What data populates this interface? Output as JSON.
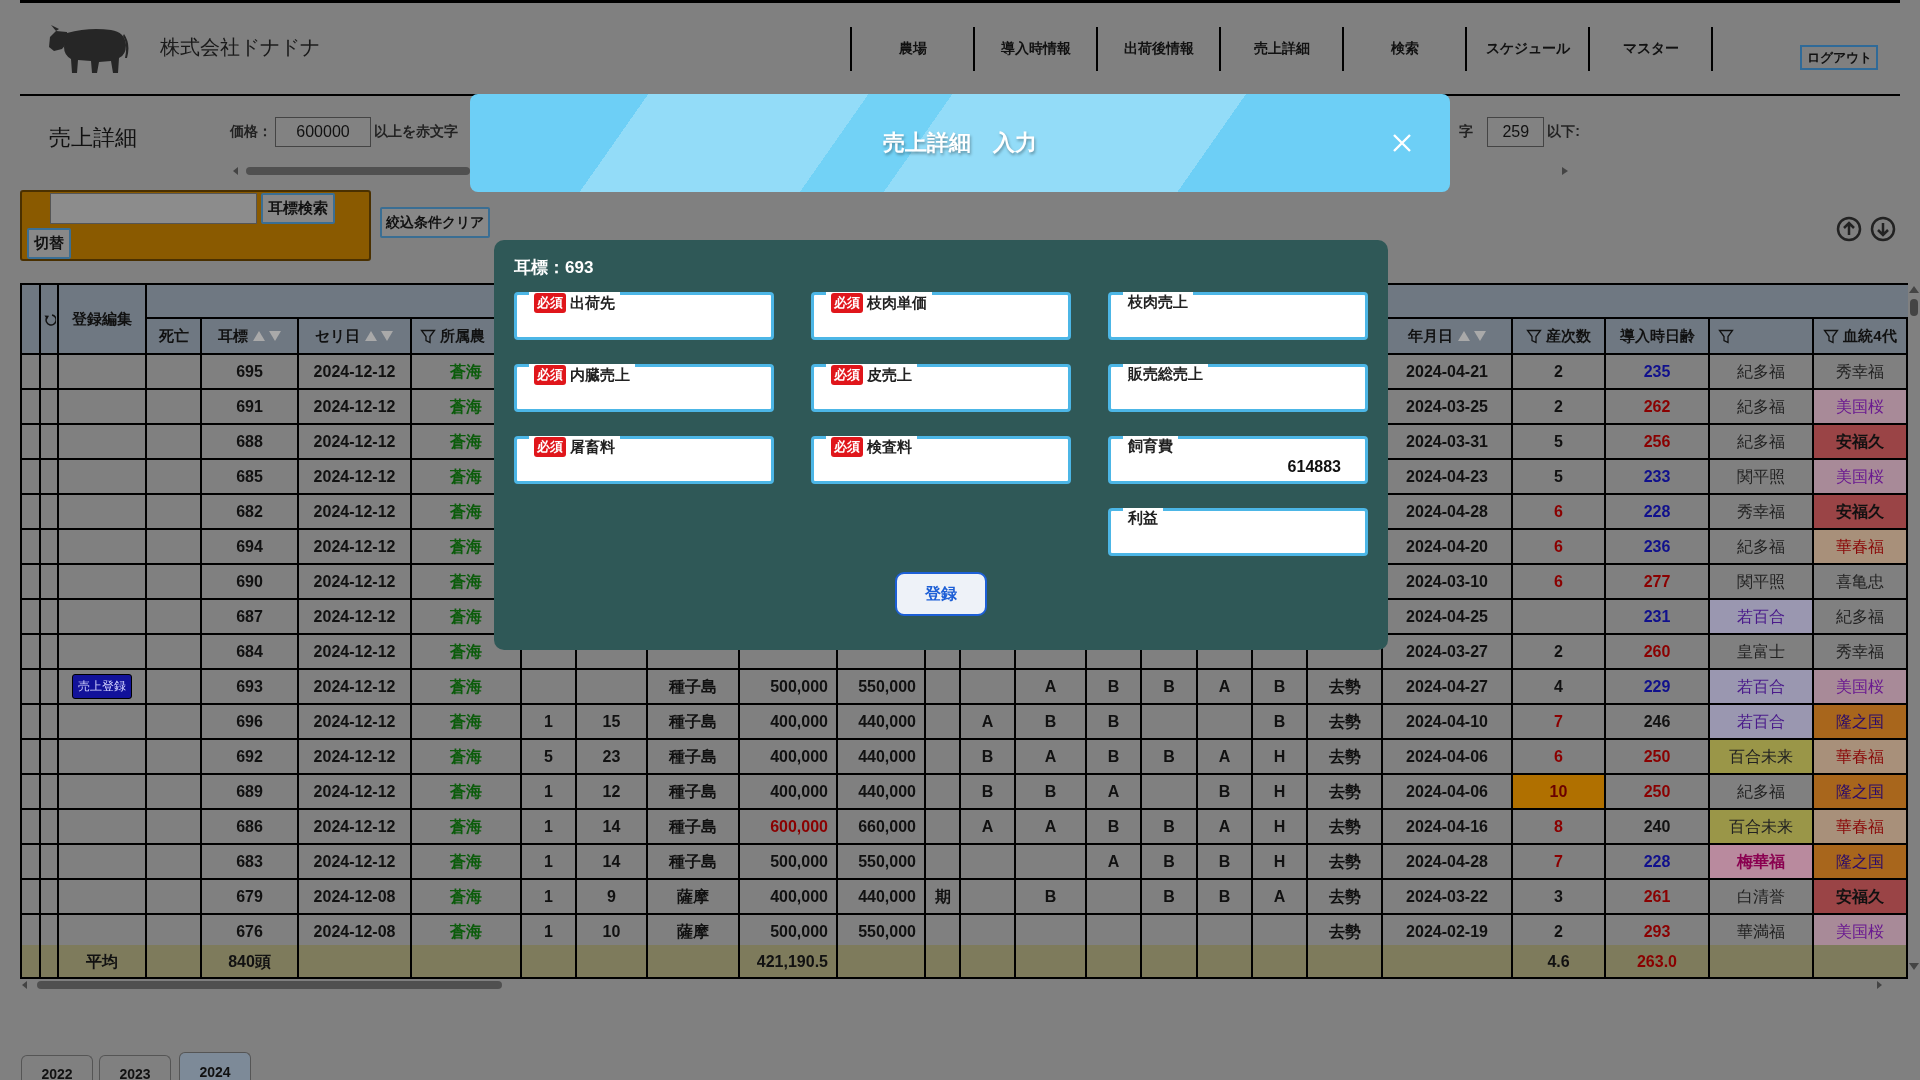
{
  "header": {
    "company": "株式会社ドナドナ",
    "nav": [
      "農場",
      "導入時情報",
      "出荷後情報",
      "売上詳細",
      "検索",
      "スケジュール",
      "マスター"
    ],
    "logout": "ログアウト"
  },
  "filters": {
    "page_title": "売上詳細",
    "price_label": "価格：",
    "price_value": "600000",
    "price_note": "以上を赤文字",
    "age_prefix": "字",
    "age_value": "259",
    "age_note": "以下:",
    "ear_tag_search": "耳標検索",
    "toggle": "切替",
    "clear": "絞込条件クリア"
  },
  "table": {
    "edit_header": "登録編集",
    "headers": {
      "dead": {
        "label": "死亡"
      },
      "ear_tag": {
        "label": "耳標",
        "sort": true
      },
      "auction_date": {
        "label": "セリ日",
        "sort": true
      },
      "farm": {
        "label": "所属農",
        "filter": true
      },
      "column_21": {
        "label": "年月日",
        "sort": true
      },
      "parity": {
        "label": "産次数",
        "filter": true
      },
      "age_at_intake": {
        "label": "導入時日齢"
      },
      "column_24": {
        "filter": true
      },
      "pedigree_4": {
        "label": "血統4代",
        "filter": true
      }
    },
    "rows": [
      {
        "ear_tag": "695",
        "auction_date": "2024-12-12",
        "farm": {
          "text": "蒼海",
          "color": "#0c5c0c"
        },
        "column_21": "2024-04-21",
        "parity": "2",
        "age_at_intake": {
          "text": "235",
          "color": "#10108c"
        },
        "column_24": "紀多福",
        "pedigree_4": "秀幸福"
      },
      {
        "ear_tag": "691",
        "auction_date": "2024-12-12",
        "farm": {
          "text": "蒼海",
          "color": "#0c5c0c"
        },
        "column_21": "2024-03-25",
        "parity": "2",
        "age_at_intake": {
          "text": "262",
          "color": "#8a0000"
        },
        "column_24": "紀多福",
        "pedigree_4": {
          "text": "美国桜",
          "color": "#6a1a90",
          "highlight": {
            "color": "#a88a98"
          }
        }
      },
      {
        "ear_tag": "688",
        "auction_date": "2024-12-12",
        "farm": {
          "text": "蒼海",
          "color": "#0c5c0c"
        },
        "column_21": "2024-03-31",
        "parity": "5",
        "age_at_intake": {
          "text": "256",
          "color": "#8a0000"
        },
        "column_24": "紀多福",
        "pedigree_4": {
          "text": "安福久",
          "bold": true,
          "highlight": {
            "color": "#9a4446"
          }
        }
      },
      {
        "ear_tag": "685",
        "auction_date": "2024-12-12",
        "farm": {
          "text": "蒼海",
          "color": "#0c5c0c"
        },
        "column_21": "2024-04-23",
        "parity": "5",
        "age_at_intake": {
          "text": "233",
          "color": "#10108c"
        },
        "column_24": "関平照",
        "pedigree_4": {
          "text": "美国桜",
          "color": "#6a1a90",
          "highlight": {
            "color": "#a88a98"
          }
        }
      },
      {
        "ear_tag": "682",
        "auction_date": "2024-12-12",
        "farm": {
          "text": "蒼海",
          "color": "#0c5c0c"
        },
        "column_21": "2024-04-28",
        "parity": {
          "text": "6",
          "color": "#8a0000"
        },
        "age_at_intake": {
          "text": "228",
          "color": "#10108c"
        },
        "column_24": "秀幸福",
        "pedigree_4": {
          "text": "安福久",
          "bold": true,
          "highlight": {
            "color": "#9a4446"
          }
        }
      },
      {
        "ear_tag": "694",
        "auction_date": "2024-12-12",
        "farm": {
          "text": "蒼海",
          "color": "#0c5c0c"
        },
        "column_21": "2024-04-20",
        "parity": {
          "text": "6",
          "color": "#8a0000"
        },
        "age_at_intake": {
          "text": "236",
          "color": "#10108c"
        },
        "column_24": "紀多福",
        "pedigree_4": {
          "text": "華春福",
          "color": "#8a0808",
          "highlight": {
            "color": "#a8907a"
          }
        }
      },
      {
        "ear_tag": "690",
        "auction_date": "2024-12-12",
        "farm": {
          "text": "蒼海",
          "color": "#0c5c0c"
        },
        "column_21": "2024-03-10",
        "parity": {
          "text": "6",
          "color": "#8a0000"
        },
        "age_at_intake": {
          "text": "277",
          "color": "#8a0000"
        },
        "column_24": "関平照",
        "pedigree_4": "喜亀忠"
      },
      {
        "ear_tag": "687",
        "auction_date": "2024-12-12",
        "farm": {
          "text": "蒼海",
          "color": "#0c5c0c"
        },
        "column_21": "2024-04-25",
        "age_at_intake": {
          "text": "231",
          "color": "#10108c"
        },
        "column_24": {
          "text": "若百合",
          "color": "#4a1a8a",
          "highlight": {
            "color": "#9a97b0"
          }
        },
        "pedigree_4": "紀多福"
      },
      {
        "ear_tag": "684",
        "auction_date": "2024-12-12",
        "farm": {
          "text": "蒼海",
          "color": "#0c5c0c"
        },
        "column_21": "2024-03-27",
        "parity": "2",
        "age_at_intake": {
          "text": "260",
          "color": "#8a0000"
        },
        "column_24": "皇富士",
        "pedigree_4": "秀幸福"
      },
      {
        "edit": {
          "kind": "button",
          "text": "売上登録"
        },
        "ear_tag": "693",
        "auction_date": "2024-12-12",
        "farm": {
          "text": "蒼海",
          "color": "#0c5c0c"
        },
        "column_10": "種子島",
        "column_11": "500,000",
        "column_12": "550,000",
        "column_15": "A",
        "column_16": "B",
        "column_17": "B",
        "column_18": "A",
        "column_19": "B",
        "column_20": "去勢",
        "column_21": "2024-04-27",
        "parity": "4",
        "age_at_intake": {
          "text": "229",
          "color": "#10108c"
        },
        "column_24": {
          "text": "若百合",
          "color": "#4a1a8a",
          "highlight": {
            "color": "#9a97b0"
          }
        },
        "pedigree_4": {
          "text": "美国桜",
          "color": "#6a1a90",
          "highlight": {
            "color": "#a88a98"
          }
        }
      },
      {
        "ear_tag": "696",
        "auction_date": "2024-12-12",
        "farm": {
          "text": "蒼海",
          "color": "#0c5c0c"
        },
        "column_8": "1",
        "column_9": "15",
        "column_10": "種子島",
        "column_11": "400,000",
        "column_12": "440,000",
        "column_14": "A",
        "column_15": "B",
        "column_16": "B",
        "column_19": "B",
        "column_20": "去勢",
        "column_21": "2024-04-10",
        "parity": {
          "text": "7",
          "color": "#8a0000"
        },
        "age_at_intake": "246",
        "column_24": {
          "text": "若百合",
          "color": "#4a1a8a",
          "highlight": {
            "color": "#9a97b0"
          }
        },
        "pedigree_4": {
          "text": "隆之国",
          "color": "#2a0a6a",
          "highlight": {
            "color": "#a8661c"
          }
        }
      },
      {
        "ear_tag": "692",
        "auction_date": "2024-12-12",
        "farm": {
          "text": "蒼海",
          "color": "#0c5c0c"
        },
        "column_8": "5",
        "column_9": "23",
        "column_10": "種子島",
        "column_11": "400,000",
        "column_12": "440,000",
        "column_14": "B",
        "column_15": "A",
        "column_16": "B",
        "column_17": "B",
        "column_18": "A",
        "column_19": "H",
        "column_20": "去勢",
        "column_21": "2024-04-06",
        "parity": {
          "text": "6",
          "color": "#8a0000"
        },
        "age_at_intake": {
          "text": "250",
          "color": "#8a0000"
        },
        "column_24": {
          "text": "百合未来",
          "highlight": {
            "color": "#9a9648"
          }
        },
        "pedigree_4": {
          "text": "華春福",
          "color": "#8a0808",
          "highlight": {
            "color": "#a8907a"
          }
        }
      },
      {
        "ear_tag": "689",
        "auction_date": "2024-12-12",
        "farm": {
          "text": "蒼海",
          "color": "#0c5c0c"
        },
        "column_8": "1",
        "column_9": "12",
        "column_10": "種子島",
        "column_11": "400,000",
        "column_12": "440,000",
        "column_14": "B",
        "column_15": "B",
        "column_16": "A",
        "column_18": "B",
        "column_19": "H",
        "column_20": "去勢",
        "column_21": "2024-04-06",
        "parity": {
          "text": "10",
          "color": "#6a0000",
          "highlight": {
            "color": "#b07000"
          }
        },
        "age_at_intake": {
          "text": "250",
          "color": "#8a0000"
        },
        "column_24": "紀多福",
        "pedigree_4": {
          "text": "隆之国",
          "color": "#2a0a6a",
          "highlight": {
            "color": "#a8661c"
          }
        }
      },
      {
        "ear_tag": "686",
        "auction_date": "2024-12-12",
        "farm": {
          "text": "蒼海",
          "color": "#0c5c0c"
        },
        "column_8": "1",
        "column_9": "14",
        "column_10": "種子島",
        "column_11": {
          "text": "600,000",
          "color": "#8a0000"
        },
        "column_12": "660,000",
        "column_14": "A",
        "column_15": "A",
        "column_16": "B",
        "column_17": "B",
        "column_18": "A",
        "column_19": "H",
        "column_20": "去勢",
        "column_21": "2024-04-16",
        "parity": {
          "text": "8",
          "color": "#8a0000"
        },
        "age_at_intake": "240",
        "column_24": {
          "text": "百合未来",
          "highlight": {
            "color": "#9a9648"
          }
        },
        "pedigree_4": {
          "text": "華春福",
          "color": "#8a0808",
          "highlight": {
            "color": "#a8907a"
          }
        }
      },
      {
        "ear_tag": "683",
        "auction_date": "2024-12-12",
        "farm": {
          "text": "蒼海",
          "color": "#0c5c0c"
        },
        "column_8": "1",
        "column_9": "14",
        "column_10": "種子島",
        "column_11": "500,000",
        "column_12": "550,000",
        "column_16": "A",
        "column_17": "B",
        "column_18": "B",
        "column_19": "H",
        "column_20": "去勢",
        "column_21": "2024-04-28",
        "parity": {
          "text": "7",
          "color": "#8a0000"
        },
        "age_at_intake": {
          "text": "228",
          "color": "#10108c"
        },
        "column_24": {
          "text": "梅華福",
          "bold": true,
          "color": "#8a0050",
          "highlight": {
            "color": "#b98a9e"
          }
        },
        "pedigree_4": {
          "text": "隆之国",
          "color": "#2a0a6a",
          "highlight": {
            "color": "#a8661c"
          }
        }
      },
      {
        "ear_tag": "679",
        "auction_date": "2024-12-08",
        "farm": {
          "text": "蒼海",
          "color": "#0c5c0c"
        },
        "column_8": "1",
        "column_9": "9",
        "column_10": "薩摩",
        "column_11": "400,000",
        "column_12": "440,000",
        "column_13": "期",
        "column_15": "B",
        "column_17": "B",
        "column_18": "B",
        "column_19": "A",
        "column_20": "去勢",
        "column_21": "2024-03-22",
        "parity": "3",
        "age_at_intake": {
          "text": "261",
          "color": "#8a0000"
        },
        "column_24": "白清誉",
        "pedigree_4": {
          "text": "安福久",
          "bold": true,
          "highlight": {
            "color": "#9a4446"
          }
        }
      },
      {
        "ear_tag": "676",
        "auction_date": "2024-12-08",
        "farm": {
          "text": "蒼海",
          "color": "#0c5c0c"
        },
        "column_8": "1",
        "column_9": "10",
        "column_10": "薩摩",
        "column_11": "500,000",
        "column_12": "550,000",
        "column_20": "去勢",
        "column_21": "2024-02-19",
        "parity": "2",
        "age_at_intake": {
          "text": "293",
          "color": "#8a0000"
        },
        "column_24": "華満福",
        "pedigree_4": {
          "text": "美国桜",
          "color": "#6a1a90",
          "highlight": {
            "color": "#a88a98"
          }
        }
      }
    ],
    "footer": {
      "edit": "平均",
      "ear_tag": "840頭",
      "column_11": "421,190.5",
      "parity": "4.6",
      "age_at_intake": {
        "text": "263.0",
        "color": "#8a0000"
      }
    }
  },
  "tabs": [
    {
      "label": "2022",
      "selected": false
    },
    {
      "label": "2023",
      "selected": false
    },
    {
      "label": "2024",
      "selected": true
    }
  ],
  "modal": {
    "title": "売上詳細　入力",
    "ear_tag": "耳標：693",
    "field_columns": [
      [
        {
          "badge": "必須",
          "label": "出荷先"
        },
        {
          "badge": "必須",
          "label": "内臓売上"
        },
        {
          "badge": "必須",
          "label": "屠畜料"
        }
      ],
      [
        {
          "badge": "必須",
          "label": "枝肉単価"
        },
        {
          "badge": "必須",
          "label": "皮売上"
        },
        {
          "badge": "必須",
          "label": "検査料"
        }
      ],
      [
        {
          "label": "枝肉売上"
        },
        {
          "label": "販売総売上"
        },
        {
          "label": "飼育費",
          "value": "614883"
        },
        {
          "label": "利益"
        }
      ]
    ],
    "submit": "登録"
  }
}
